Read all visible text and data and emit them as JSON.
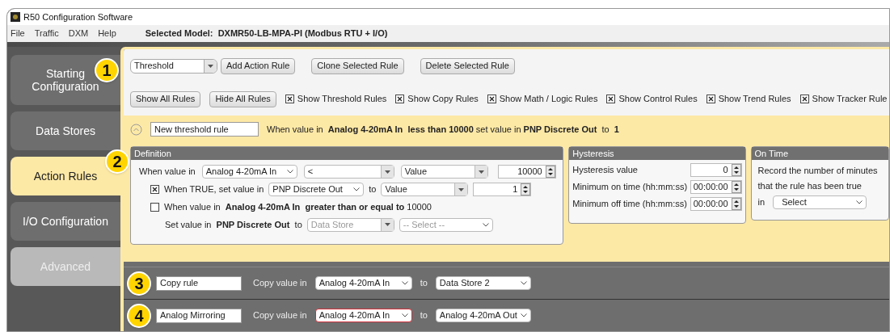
{
  "window": {
    "title": "R50 Configuration Software"
  },
  "menu": [
    "File",
    "Traffic",
    "DXM",
    "Help"
  ],
  "selected_model": {
    "label": "Selected Model:",
    "value": "DXMR50-LB-MPA-PI (Modbus RTU + I/O)"
  },
  "sidebar": {
    "items": [
      {
        "label": "Starting Configuration",
        "selected": false,
        "disabled": false
      },
      {
        "label": "Data Stores",
        "selected": false,
        "disabled": false
      },
      {
        "label": "Action Rules",
        "selected": true,
        "disabled": false
      },
      {
        "label": "I/O Configuration",
        "selected": false,
        "disabled": false
      },
      {
        "label": "Advanced",
        "selected": false,
        "disabled": true
      }
    ]
  },
  "toolbar": {
    "rule_type": "Threshold",
    "buttons": [
      "Add Action Rule",
      "Clone Selected Rule",
      "Delete Selected Rule"
    ],
    "show_buttons": [
      "Show All Rules",
      "Hide All Rules"
    ],
    "filters": [
      {
        "label": "Show Threshold Rules",
        "checked": true
      },
      {
        "label": "Show Copy Rules",
        "checked": true
      },
      {
        "label": "Show Math / Logic Rules",
        "checked": true
      },
      {
        "label": "Show Control Rules",
        "checked": true
      },
      {
        "label": "Show Trend Rules",
        "checked": true
      },
      {
        "label": "Show Tracker Rule",
        "checked": true
      }
    ]
  },
  "threshold_rule": {
    "name": "New threshold rule",
    "summary": "When value in  **Analog 4-20mA In**  **less than 10000** set value in **PNP Discrete Out**  to  **1**",
    "definition": {
      "title": "Definition",
      "when_label": "When value in",
      "source": "Analog 4-20mA In",
      "operator": "<",
      "compare_type": "Value",
      "compare_value": "10000",
      "true_checked": true,
      "true_label": "When TRUE, set value in",
      "true_target": "PNP Discrete Out",
      "to_label": "to",
      "true_type": "Value",
      "true_value": "1",
      "false_checked": false,
      "false_label": "When value in  **Analog 4-20mA In**  **greater than or equal to** 10000",
      "set_label": "Set value in  **PNP Discrete Out**  to",
      "false_type": "Data Store",
      "false_select": "-- Select --"
    },
    "hysteresis": {
      "title": "Hysteresis",
      "rows": [
        {
          "label": "Hysteresis value",
          "value": "0"
        },
        {
          "label": "Minimum on time (hh:mm:ss)",
          "value": "00:00:00"
        },
        {
          "label": "Minimum off time (hh:mm:ss)",
          "value": "00:00:00"
        }
      ]
    },
    "on_time": {
      "title": "On Time",
      "text": "Record the number of minutes that the rule has been true",
      "in_label": "in",
      "select": "Select"
    }
  },
  "copy_rules": [
    {
      "name": "Copy rule",
      "label": "Copy value in",
      "source": "Analog 4-20mA In",
      "to_label": "to",
      "target": "Data Store 2",
      "highlighted": false
    },
    {
      "name": "Analog Mirroring",
      "label": "Copy value in",
      "source": "Analog 4-20mA In",
      "to_label": "to",
      "target": "Analog 4-20mA Out",
      "highlighted": true
    }
  ],
  "callouts": [
    "1",
    "2",
    "3",
    "4"
  ]
}
